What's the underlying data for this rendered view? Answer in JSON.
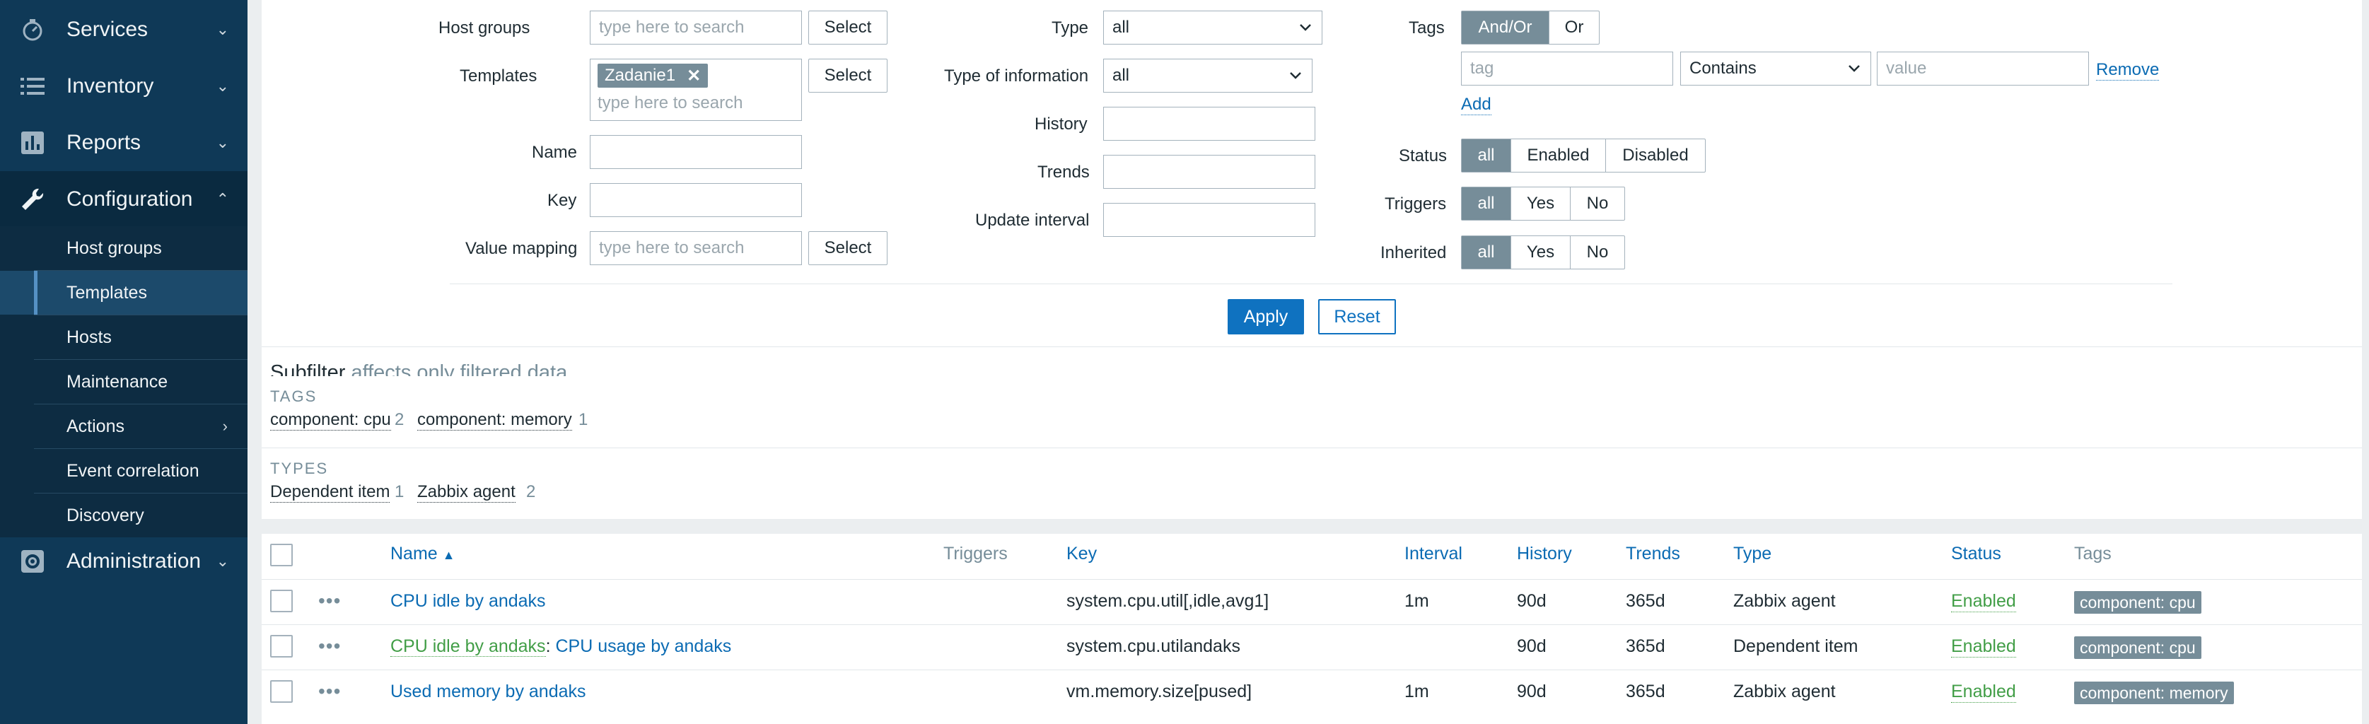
{
  "sidebar": {
    "menu": [
      {
        "label": "Services",
        "icon": "stopwatch-icon"
      },
      {
        "label": "Inventory",
        "icon": "list-icon"
      },
      {
        "label": "Reports",
        "icon": "bar-chart-icon"
      },
      {
        "label": "Configuration",
        "icon": "wrench-icon"
      },
      {
        "label": "Administration",
        "icon": "gear-icon"
      }
    ],
    "submenu": [
      {
        "label": "Host groups"
      },
      {
        "label": "Templates"
      },
      {
        "label": "Hosts"
      },
      {
        "label": "Maintenance"
      },
      {
        "label": "Actions"
      },
      {
        "label": "Event correlation"
      },
      {
        "label": "Discovery"
      }
    ]
  },
  "filter": {
    "host_groups_label": "Host groups",
    "host_groups_placeholder": "type here to search",
    "templates_label": "Templates",
    "templates_chip": "Zadanie1",
    "templates_placeholder": "type here to search",
    "name_label": "Name",
    "name_value": "",
    "key_label": "Key",
    "key_value": "",
    "value_mapping_label": "Value mapping",
    "value_mapping_placeholder": "type here to search",
    "select_label": "Select",
    "type_label": "Type",
    "type_value": "all",
    "type_info_label": "Type of information",
    "type_info_value": "all",
    "history_label": "History",
    "trends_label": "Trends",
    "update_interval_label": "Update interval",
    "tags_label": "Tags",
    "tags_andor": "And/Or",
    "tags_or": "Or",
    "tag_placeholder": "tag",
    "tag_operator": "Contains",
    "value_placeholder": "value",
    "remove_label": "Remove",
    "add_label": "Add",
    "status_label": "Status",
    "status_all": "all",
    "status_enabled": "Enabled",
    "status_disabled": "Disabled",
    "triggers_label": "Triggers",
    "triggers_all": "all",
    "triggers_yes": "Yes",
    "triggers_no": "No",
    "inherited_label": "Inherited",
    "inherited_all": "all",
    "inherited_yes": "Yes",
    "inherited_no": "No",
    "apply_label": "Apply",
    "reset_label": "Reset"
  },
  "subfilter": {
    "title": "Subfilter",
    "subtitle": "affects only filtered data",
    "tags_heading": "TAGS",
    "tags": [
      {
        "label": "component: cpu",
        "count": "2"
      },
      {
        "label": "component: memory",
        "count": "1"
      }
    ],
    "types_heading": "TYPES",
    "types": [
      {
        "label": "Dependent item",
        "count": "1"
      },
      {
        "label": "Zabbix agent",
        "count": "2"
      }
    ]
  },
  "table": {
    "headers": {
      "name": "Name",
      "triggers": "Triggers",
      "key": "Key",
      "interval": "Interval",
      "history": "History",
      "trends": "Trends",
      "type": "Type",
      "status": "Status",
      "tags": "Tags"
    },
    "rows": [
      {
        "dots": "•••",
        "name": "CPU idle by andaks",
        "name_prefix": "",
        "key": "system.cpu.util[,idle,avg1]",
        "interval": "1m",
        "history": "90d",
        "trends": "365d",
        "type": "Zabbix agent",
        "status": "Enabled",
        "tag": "component: cpu"
      },
      {
        "dots": "•••",
        "name": "CPU usage by andaks",
        "name_prefix": "CPU idle by andaks",
        "key": "system.cpu.utilandaks",
        "interval": "",
        "history": "90d",
        "trends": "365d",
        "type": "Dependent item",
        "status": "Enabled",
        "tag": "component: cpu"
      },
      {
        "dots": "•••",
        "name": "Used memory by andaks",
        "name_prefix": "",
        "key": "vm.memory.size[pused]",
        "interval": "1m",
        "history": "90d",
        "trends": "365d",
        "type": "Zabbix agent",
        "status": "Enabled",
        "tag": "component: memory"
      }
    ]
  }
}
